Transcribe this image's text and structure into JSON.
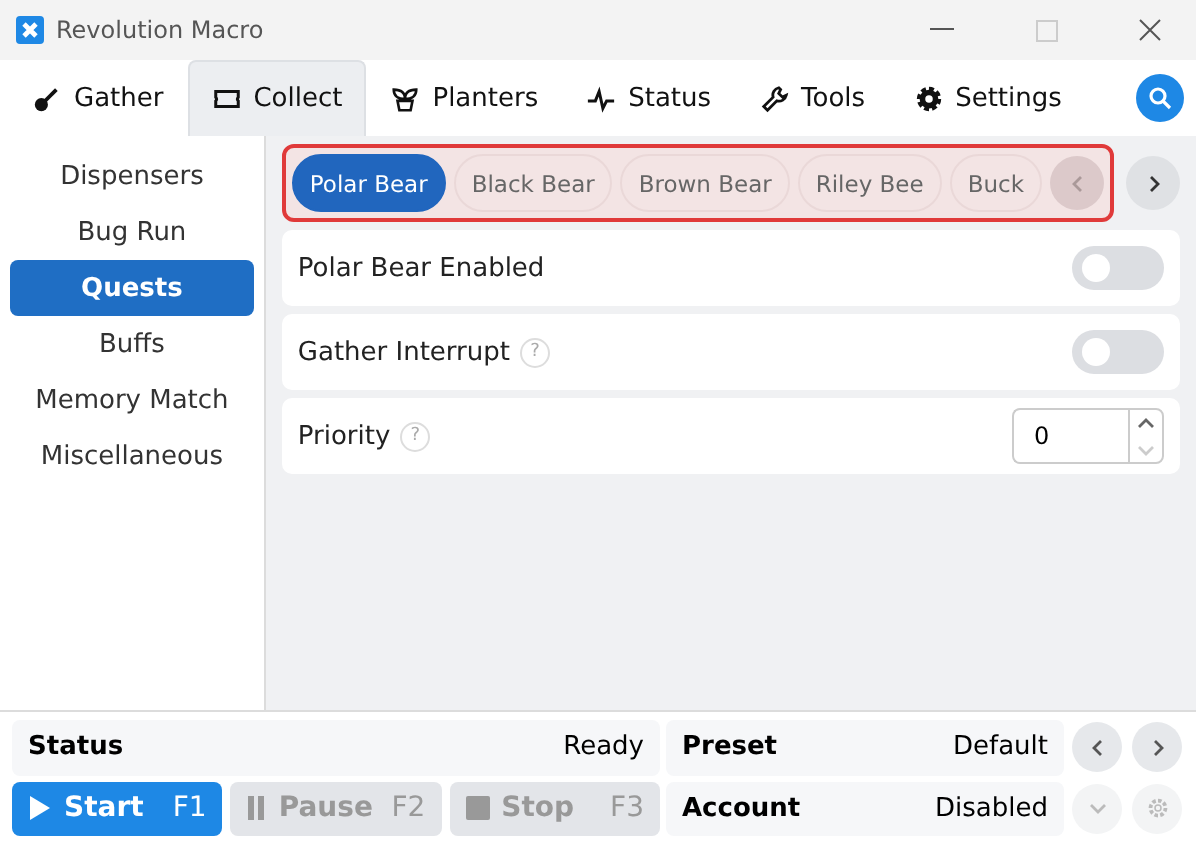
{
  "window": {
    "title": "Revolution Macro"
  },
  "tabs": [
    {
      "label": "Gather",
      "selected": false
    },
    {
      "label": "Collect",
      "selected": true
    },
    {
      "label": "Planters",
      "selected": false
    },
    {
      "label": "Status",
      "selected": false
    },
    {
      "label": "Tools",
      "selected": false
    },
    {
      "label": "Settings",
      "selected": false
    }
  ],
  "sidebar": {
    "items": [
      {
        "label": "Dispensers",
        "selected": false
      },
      {
        "label": "Bug Run",
        "selected": false
      },
      {
        "label": "Quests",
        "selected": true
      },
      {
        "label": "Buffs",
        "selected": false
      },
      {
        "label": "Memory Match",
        "selected": false
      },
      {
        "label": "Miscellaneous",
        "selected": false
      }
    ]
  },
  "quest_chips": [
    {
      "label": "Polar Bear",
      "selected": true
    },
    {
      "label": "Black Bear",
      "selected": false
    },
    {
      "label": "Brown Bear",
      "selected": false
    },
    {
      "label": "Riley Bee",
      "selected": false
    },
    {
      "label": "Buck",
      "selected": false
    }
  ],
  "settings": [
    {
      "kind": "toggle",
      "label": "Polar Bear Enabled",
      "on": false
    },
    {
      "kind": "toggle",
      "label": "Gather Interrupt",
      "help": "?",
      "on": false
    },
    {
      "kind": "number",
      "label": "Priority",
      "help": "?",
      "value": "0"
    }
  ],
  "status_bar": {
    "status_label": "Status",
    "status_value": "Ready",
    "preset_label": "Preset",
    "preset_value": "Default",
    "account_label": "Account",
    "account_value": "Disabled",
    "buttons": [
      {
        "kind": "start",
        "label": "Start",
        "key": "F1",
        "disabled": false
      },
      {
        "kind": "pause",
        "label": "Pause",
        "key": "F2",
        "disabled": true
      },
      {
        "kind": "stop",
        "label": "Stop",
        "key": "F3",
        "disabled": true
      }
    ]
  }
}
